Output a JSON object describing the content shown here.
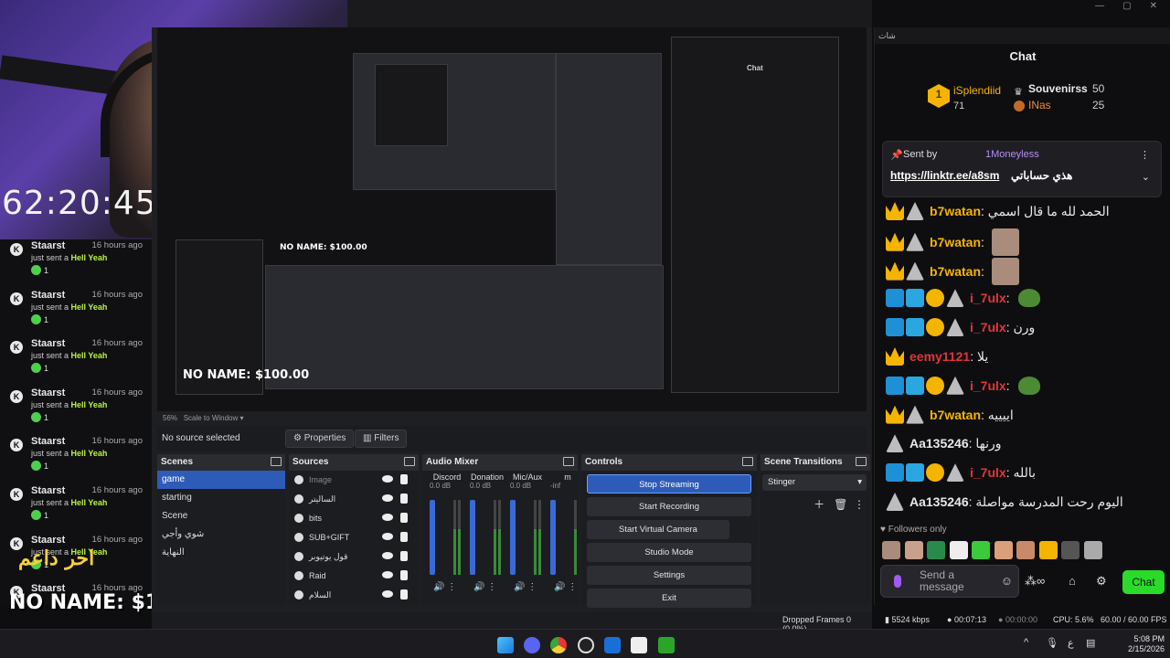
{
  "stream": {
    "timer": "62:20:45",
    "overlay_arabic": "احر داعم",
    "overlay_top_donor": "NO NAME: $100.00"
  },
  "window_controls": [
    "—",
    "▢",
    "✕"
  ],
  "alerts": {
    "items": [
      {
        "name": "Staarst",
        "time": "16 hours ago",
        "text": "just sent a",
        "highlight": "Hell Yeah",
        "bits": "1"
      },
      {
        "name": "Staarst",
        "time": "16 hours ago",
        "text": "just sent a",
        "highlight": "Hell Yeah",
        "bits": "1"
      },
      {
        "name": "Staarst",
        "time": "16 hours ago",
        "text": "just sent a",
        "highlight": "Hell Yeah",
        "bits": "1"
      },
      {
        "name": "Staarst",
        "time": "16 hours ago",
        "text": "just sent a",
        "highlight": "Hell Yeah",
        "bits": "1"
      },
      {
        "name": "Staarst",
        "time": "16 hours ago",
        "text": "just sent a",
        "highlight": "Hell Yeah",
        "bits": "1"
      },
      {
        "name": "Staarst",
        "time": "16 hours ago",
        "text": "just sent a",
        "highlight": "Hell Yeah",
        "bits": "1"
      },
      {
        "name": "Staarst",
        "time": "16 hours ago",
        "text": "just sent a",
        "highlight": "Hell Yeah",
        "bits": "1"
      },
      {
        "name": "Staarst",
        "time": "16 hours ago",
        "text": "",
        "highlight": "",
        "bits": ""
      }
    ]
  },
  "obs": {
    "scale": "56%",
    "scale_mode": "Scale to Window",
    "no_source": "No source selected",
    "properties_label": "Properties",
    "filters_label": "Filters",
    "scenes": {
      "title": "Scenes",
      "items": [
        "game",
        "starting",
        "Scene",
        "شوي وأجي",
        "النهاية"
      ]
    },
    "sources": {
      "title": "Sources",
      "items": [
        "Image",
        "الساليتر",
        "bits",
        "SUB+GIFT",
        "قول يوتيوبر",
        "Raid",
        "السلام"
      ]
    },
    "mixer": {
      "title": "Audio Mixer",
      "channels": [
        {
          "name": "Discord",
          "db": "0.0 dB"
        },
        {
          "name": "Donation",
          "db": "0.0 dB"
        },
        {
          "name": "Mic/Aux",
          "db": "0.0 dB"
        },
        {
          "name": "m",
          "db": "-inf"
        }
      ],
      "scale": [
        "5",
        "0",
        "-5",
        "-10",
        "-15",
        "-20",
        "-25",
        "-30",
        "-35",
        "-40",
        "-45",
        "-50",
        "-55",
        "-60"
      ]
    },
    "controls": {
      "title": "Controls",
      "buttons": [
        "Stop Streaming",
        "Start Recording",
        "Start Virtual Camera",
        "Studio Mode",
        "Settings",
        "Exit"
      ]
    },
    "transitions": {
      "title": "Scene Transitions",
      "selected": "Stinger"
    },
    "status": {
      "dropped": "Dropped Frames 0 (0.0%)",
      "bitrate": "5524 kbps",
      "stream_time": "00:07:13",
      "rec_time": "00:00:00",
      "cpu": "CPU: 5.6%",
      "fps": "60.00 / 60.00 FPS"
    }
  },
  "chat": {
    "tab_label": "شات",
    "title": "Chat",
    "leaders": [
      {
        "rank": "1",
        "name": "iSplendiid",
        "count": "71"
      },
      {
        "rank": "",
        "name": "Souvenirss",
        "count": "50"
      },
      {
        "rank": "3",
        "name": "INas",
        "count": "25"
      }
    ],
    "pinned": {
      "sent_by": "Sent by",
      "user": "1Moneyless",
      "link": "https://linktr.ee/a8sm",
      "text": "هذي حساباتي"
    },
    "messages": [
      {
        "user": "b7watan",
        "color": "#f4b400",
        "text": "الحمد لله ما قال اسمي",
        "badges": [
          "crownic",
          "tri"
        ],
        "emote": false,
        "frog": false
      },
      {
        "user": "b7watan",
        "color": "#f4b400",
        "text": "",
        "badges": [
          "crownic",
          "tri"
        ],
        "emote": true,
        "frog": false
      },
      {
        "user": "b7watan",
        "color": "#f4b400",
        "text": "",
        "badges": [
          "crownic",
          "tri"
        ],
        "emote": true,
        "frog": false
      },
      {
        "user": "i_7ulx",
        "color": "#e0353a",
        "text": "",
        "badges": [
          "hammer",
          "blue",
          "coin",
          "tri"
        ],
        "emote": false,
        "frog": true
      },
      {
        "user": "i_7ulx",
        "color": "#e0353a",
        "text": "ورن",
        "badges": [
          "hammer",
          "blue",
          "coin",
          "tri"
        ],
        "emote": false,
        "frog": false
      },
      {
        "user": "eemy1121",
        "color": "#e0353a",
        "text": "يلا",
        "badges": [
          "crownic"
        ],
        "emote": false,
        "frog": false
      },
      {
        "user": "i_7ulx",
        "color": "#e0353a",
        "text": "",
        "badges": [
          "hammer",
          "blue",
          "coin",
          "tri"
        ],
        "emote": false,
        "frog": true
      },
      {
        "user": "b7watan",
        "color": "#f4b400",
        "text": "اييييه",
        "badges": [
          "crownic",
          "tri"
        ],
        "emote": false,
        "frog": false
      },
      {
        "user": "Aa135246",
        "color": "#e8e8ea",
        "text": "ورنها",
        "badges": [
          "tri"
        ],
        "emote": false,
        "frog": false
      },
      {
        "user": "i_7ulx",
        "color": "#e0353a",
        "text": "بالله",
        "badges": [
          "hammer",
          "blue",
          "coin",
          "tri"
        ],
        "emote": false,
        "frog": false
      },
      {
        "user": "Aa135246",
        "color": "#e8e8ea",
        "text": "اليوم رحت المدرسة مواصلة",
        "badges": [
          "tri"
        ],
        "emote": false,
        "frog": false
      }
    ],
    "followers_only": "Followers only",
    "input_placeholder": "Send a message",
    "send_label": "Chat"
  },
  "taskbar": {
    "time": "5:08 PM",
    "date": "2/15/2026",
    "lang": "ع"
  }
}
